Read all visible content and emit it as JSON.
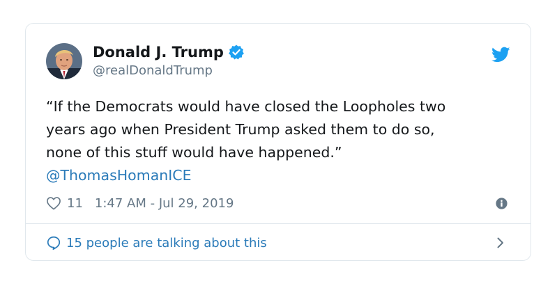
{
  "tweet": {
    "display_name": "Donald J. Trump",
    "handle": "@realDonaldTrump",
    "text_lines": [
      "“If the Democrats would have closed the Loopholes two",
      "years ago when President Trump asked them to do so,",
      "none of this stuff would have happened.”"
    ],
    "mention": "@ThomasHomanICE",
    "like_count": "11",
    "timestamp": "1:47 AM - Jul 29, 2019",
    "talking_about": "15 people are talking about this"
  },
  "icons": {
    "verified": "verified-badge-icon",
    "brand": "twitter-bird-icon",
    "like": "heart-icon",
    "info": "info-icon",
    "comment": "comment-icon",
    "chevron": "chevron-right-icon"
  },
  "colors": {
    "brand_blue": "#1da1f2",
    "link_blue": "#2b7bb9",
    "text": "#14171a",
    "muted": "#657786",
    "border": "#e1e8ed"
  }
}
